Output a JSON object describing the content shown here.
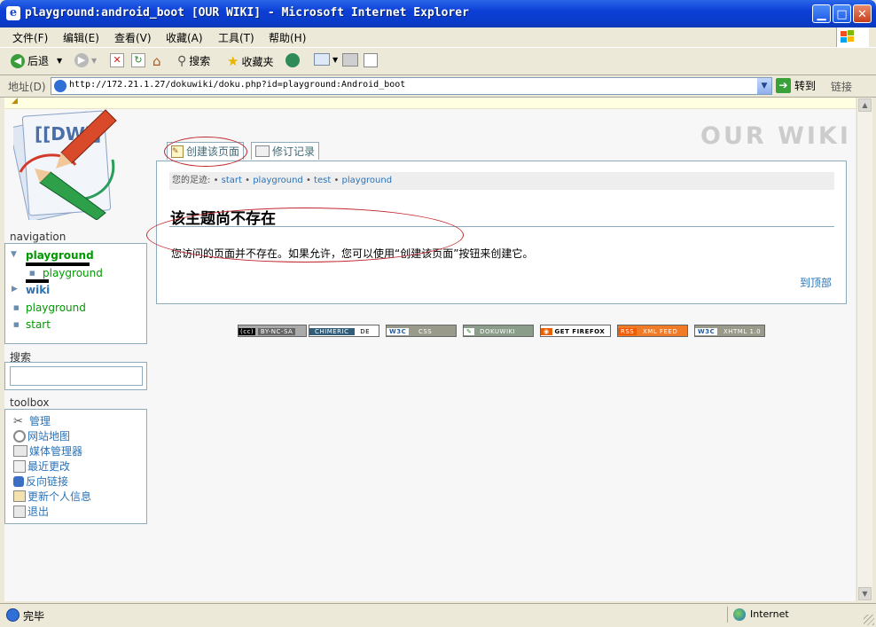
{
  "window": {
    "title": "playground:android_boot [OUR WIKI] - Microsoft Internet Explorer",
    "icon": "ie-icon",
    "controls": [
      "minimize-icon",
      "maximize-icon",
      "close-icon"
    ]
  },
  "menubar": {
    "items": [
      "文件(F)",
      "编辑(E)",
      "查看(V)",
      "收藏(A)",
      "工具(T)",
      "帮助(H)"
    ]
  },
  "toolbar": {
    "back_label": "后退",
    "search_label": "搜索",
    "favorites_label": "收藏夹"
  },
  "addressbar": {
    "label": "地址(D)",
    "url": "http://172.21.1.27/dokuwiki/doku.php?id=playground:Android_boot",
    "go_label": "转到",
    "links_label": "链接"
  },
  "wiki": {
    "site_title": "OUR WIKI",
    "logo_text": "[[DW]]",
    "tabs": [
      "创建该页面",
      "修订记录"
    ],
    "breadcrumb": {
      "label": "您的足迹:",
      "items": [
        "start",
        "playground",
        "test",
        "playground"
      ]
    },
    "heading": "该主题尚不存在",
    "description": "您访问的页面并不存在。如果允许，您可以使用“创建该页面”按钮来创建它。",
    "to_top": "到顶部"
  },
  "sidebar": {
    "navigation_title": "navigation",
    "nav_items": [
      {
        "label": "playground",
        "marker": "▼"
      },
      {
        "label": "playground",
        "marker": "■"
      },
      {
        "label": "wiki",
        "marker": "▶"
      },
      {
        "label": "playground",
        "marker": "■"
      },
      {
        "label": "start",
        "marker": "■"
      }
    ],
    "search_title": "搜索",
    "toolbox_title": "toolbox",
    "toolbox_items": [
      "管理",
      "网站地图",
      "媒体管理器",
      "最近更改",
      "反向链接",
      "更新个人信息",
      "退出"
    ]
  },
  "badges": {
    "cc": "BY-NC-SA",
    "chimeric": "CHIMERIC",
    "de": "DE",
    "css": "CSS",
    "dokuwiki": "DOKUWIKI",
    "firefox": "GET FIREFOX",
    "rss": "XML FEED",
    "xhtml": "XHTML 1.0"
  },
  "statusbar": {
    "status": "完毕",
    "zone": "Internet"
  },
  "colors": {
    "titlebar": "#0c3fd6",
    "link": "#2b73b7",
    "link_current": "#009900",
    "annotation": "#c0282e"
  }
}
